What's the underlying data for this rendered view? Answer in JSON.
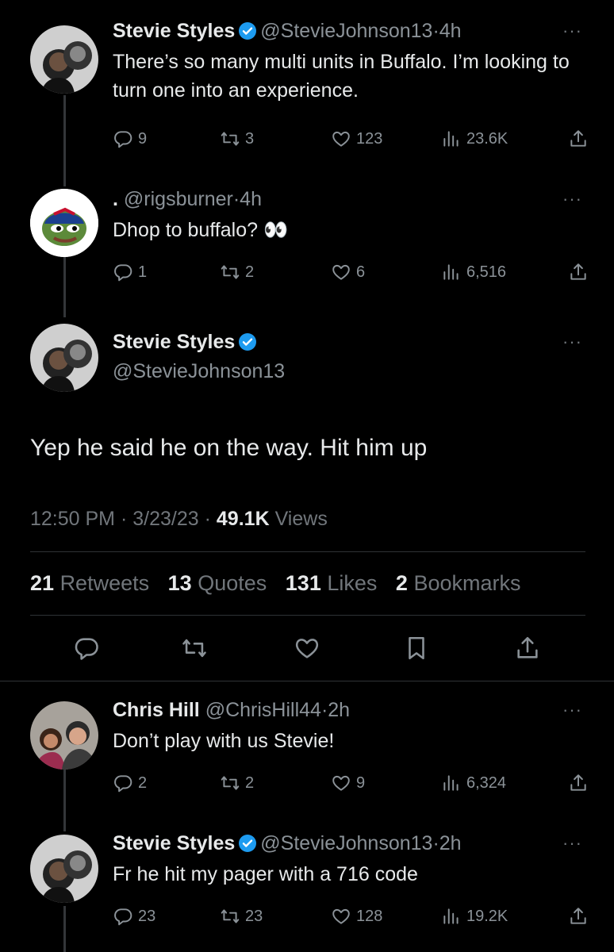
{
  "tweets": [
    {
      "name": "Stevie Styles",
      "handle": "@StevieJohnson13",
      "dot": "·",
      "time": "4h",
      "text": "There’s so many multi units in Buffalo. I’m looking to turn one into an experience.",
      "replies": "9",
      "retweets": "3",
      "likes": "123",
      "views": "23.6K"
    },
    {
      "name": ".",
      "handle": "@rigsburner",
      "dot": "·",
      "time": "4h",
      "text": "Dhop to buffalo? 👀",
      "replies": "1",
      "retweets": "2",
      "likes": "6",
      "views": "6,516"
    },
    {
      "name": "Chris Hill",
      "handle": "@ChrisHill44",
      "dot": "·",
      "time": "2h",
      "text": "Don’t play with us Stevie!",
      "replies": "2",
      "retweets": "2",
      "likes": "9",
      "views": "6,324"
    },
    {
      "name": "Stevie Styles",
      "handle": "@StevieJohnson13",
      "dot": "·",
      "time": "2h",
      "text": "Fr he hit my pager with a 716 code",
      "replies": "23",
      "retweets": "23",
      "likes": "128",
      "views": "19.2K"
    }
  ],
  "main_tweet": {
    "name": "Stevie Styles",
    "handle": "@StevieJohnson13",
    "text": "Yep he said he on the way. Hit him up",
    "time": "12:50 PM",
    "date": "3/23/23",
    "dot": "·",
    "views_count": "49.1K",
    "views_label": "Views",
    "stats": {
      "retweets_count": "21",
      "retweets_label": "Retweets",
      "quotes_count": "13",
      "quotes_label": "Quotes",
      "likes_count": "131",
      "likes_label": "Likes",
      "bookmarks_count": "2",
      "bookmarks_label": "Bookmarks"
    }
  },
  "more_glyph": "···",
  "colors": {
    "background": "#000000",
    "text": "#e7e9ea",
    "muted": "#8b9298",
    "verified": "#1d9bf0",
    "divider": "#2f3336"
  }
}
